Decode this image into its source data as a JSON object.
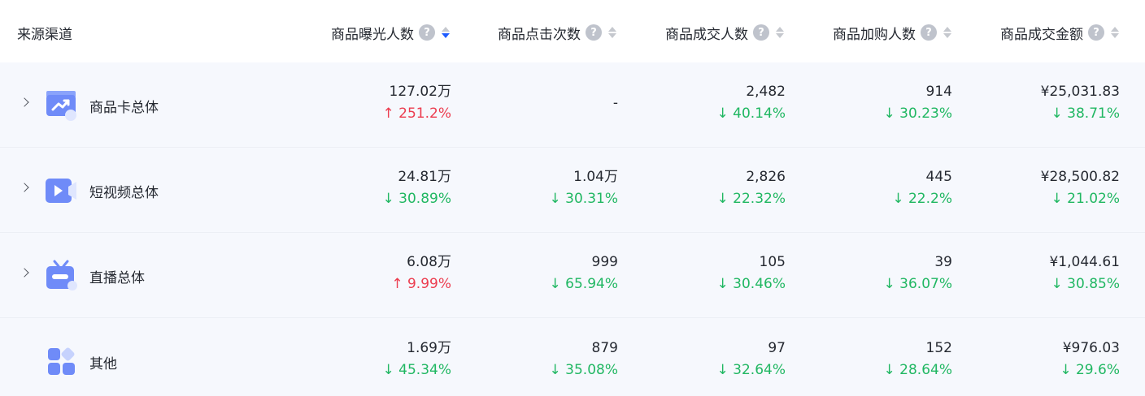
{
  "header": {
    "source": "来源渠道",
    "cols": [
      {
        "label": "商品曝光人数",
        "sort_active": true
      },
      {
        "label": "商品点击次数",
        "sort_active": false
      },
      {
        "label": "商品成交人数",
        "sort_active": false
      },
      {
        "label": "商品加购人数",
        "sort_active": false
      },
      {
        "label": "商品成交金额",
        "sort_active": false
      }
    ],
    "help_glyph": "?"
  },
  "rows": [
    {
      "name": "商品卡总体",
      "icon": "product-card-icon",
      "expandable": true,
      "cells": [
        {
          "value": "127.02万",
          "change": "↑ 251.2%",
          "dir": "up"
        },
        {
          "value": "-",
          "change": "",
          "dir": ""
        },
        {
          "value": "2,482",
          "change": "↓ 40.14%",
          "dir": "down"
        },
        {
          "value": "914",
          "change": "↓ 30.23%",
          "dir": "down"
        },
        {
          "value": "¥25,031.83",
          "change": "↓ 38.71%",
          "dir": "down"
        }
      ]
    },
    {
      "name": "短视频总体",
      "icon": "short-video-icon",
      "expandable": true,
      "cells": [
        {
          "value": "24.81万",
          "change": "↓ 30.89%",
          "dir": "down"
        },
        {
          "value": "1.04万",
          "change": "↓ 30.31%",
          "dir": "down"
        },
        {
          "value": "2,826",
          "change": "↓ 22.32%",
          "dir": "down"
        },
        {
          "value": "445",
          "change": "↓ 22.2%",
          "dir": "down"
        },
        {
          "value": "¥28,500.82",
          "change": "↓ 21.02%",
          "dir": "down"
        }
      ]
    },
    {
      "name": "直播总体",
      "icon": "live-tv-icon",
      "expandable": true,
      "cells": [
        {
          "value": "6.08万",
          "change": "↑ 9.99%",
          "dir": "up"
        },
        {
          "value": "999",
          "change": "↓ 65.94%",
          "dir": "down"
        },
        {
          "value": "105",
          "change": "↓ 30.46%",
          "dir": "down"
        },
        {
          "value": "39",
          "change": "↓ 36.07%",
          "dir": "down"
        },
        {
          "value": "¥1,044.61",
          "change": "↓ 30.85%",
          "dir": "down"
        }
      ]
    },
    {
      "name": "其他",
      "icon": "other-grid-icon",
      "expandable": false,
      "cells": [
        {
          "value": "1.69万",
          "change": "↓ 45.34%",
          "dir": "down"
        },
        {
          "value": "879",
          "change": "↓ 35.08%",
          "dir": "down"
        },
        {
          "value": "97",
          "change": "↓ 32.64%",
          "dir": "down"
        },
        {
          "value": "152",
          "change": "↓ 28.64%",
          "dir": "down"
        },
        {
          "value": "¥976.03",
          "change": "↓ 29.6%",
          "dir": "down"
        }
      ]
    }
  ],
  "colors": {
    "up": "#ec3c4f",
    "down": "#20b762",
    "sort_active": "#1f5cff",
    "icon_primary": "#6f8bf8"
  }
}
